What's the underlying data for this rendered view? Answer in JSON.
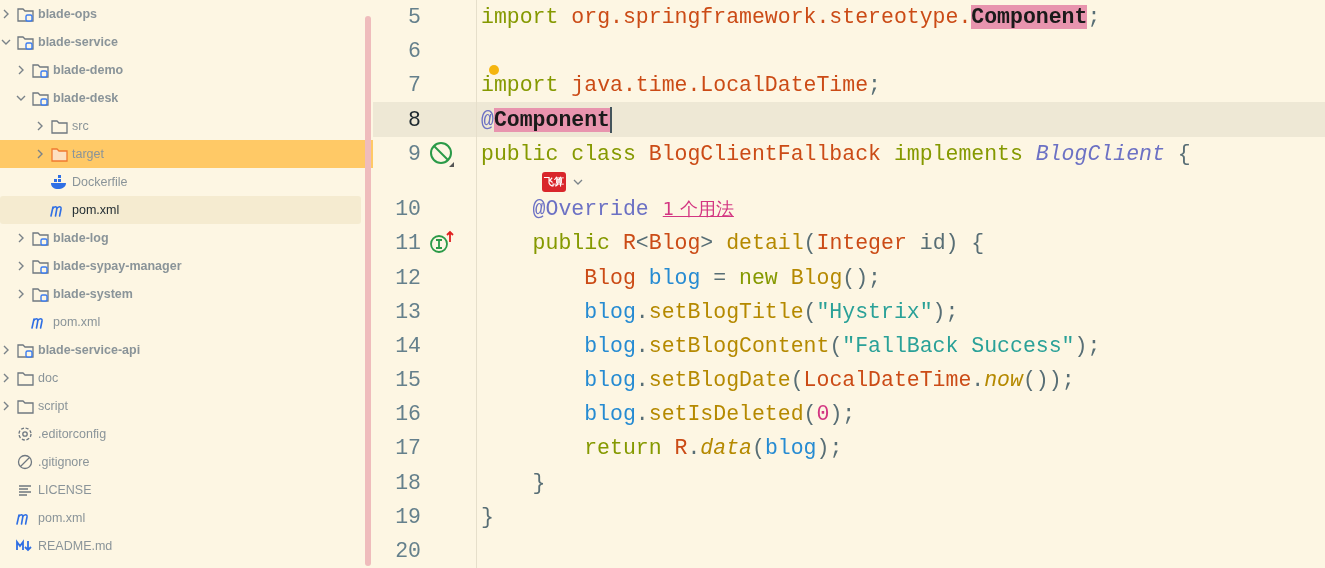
{
  "project_tree": {
    "items": [
      {
        "label": "blade-ops",
        "kind": "module",
        "expanded": false,
        "selected": false
      },
      {
        "label": "blade-service",
        "kind": "module",
        "expanded": true,
        "selected": false,
        "children": [
          {
            "label": "blade-demo",
            "kind": "module",
            "expanded": false,
            "selected": false
          },
          {
            "label": "blade-desk",
            "kind": "module",
            "expanded": true,
            "selected": false,
            "children": [
              {
                "label": "src",
                "kind": "folder",
                "expanded": false,
                "selected": false
              },
              {
                "label": "target",
                "kind": "excluded-folder",
                "expanded": false,
                "selected": false
              },
              {
                "label": "Dockerfile",
                "kind": "docker",
                "selected": false
              },
              {
                "label": "pom.xml",
                "kind": "maven",
                "selected": true
              }
            ]
          },
          {
            "label": "blade-log",
            "kind": "module",
            "expanded": false,
            "selected": false
          },
          {
            "label": "blade-sypay-manager",
            "kind": "module",
            "expanded": false,
            "selected": false
          },
          {
            "label": "blade-system",
            "kind": "module",
            "expanded": false,
            "selected": false
          },
          {
            "label": "pom.xml",
            "kind": "maven",
            "selected": false
          }
        ]
      },
      {
        "label": "blade-service-api",
        "kind": "module",
        "expanded": false,
        "selected": false
      },
      {
        "label": "doc",
        "kind": "folder",
        "expanded": false,
        "selected": false
      },
      {
        "label": "script",
        "kind": "folder",
        "expanded": false,
        "selected": false
      },
      {
        "label": ".editorconfig",
        "kind": "settings",
        "selected": false
      },
      {
        "label": ".gitignore",
        "kind": "ignore",
        "selected": false
      },
      {
        "label": "LICENSE",
        "kind": "text",
        "selected": false
      },
      {
        "label": "pom.xml",
        "kind": "maven",
        "selected": false
      },
      {
        "label": "README.md",
        "kind": "markdown",
        "selected": false
      }
    ]
  },
  "editor": {
    "lines": [
      {
        "number": "5",
        "selected": false,
        "tokens": [
          {
            "text": "import",
            "kind": "keyword"
          },
          {
            "text": " org.springframework.stereotype.",
            "kind": "class"
          },
          {
            "text": "Component",
            "kind": "match"
          },
          {
            "text": ";",
            "kind": "punct"
          }
        ]
      },
      {
        "number": "6",
        "selected": false
      },
      {
        "number": "7",
        "selected": false,
        "intention": {
          "kind": "bulb"
        },
        "tokens": [
          {
            "text": "import",
            "kind": "keyword"
          },
          {
            "text": " java.time.LocalDateTime",
            "kind": "class"
          },
          {
            "text": ";",
            "kind": "punct"
          }
        ]
      },
      {
        "number": "8",
        "selected": true,
        "tokens": [
          {
            "text": "@",
            "kind": "annotation"
          },
          {
            "text": "Component",
            "kind": "match"
          }
        ]
      },
      {
        "number": "9",
        "selected": false,
        "gutter": {
          "kind": "no-entry"
        },
        "tokens": [
          {
            "text": "public class ",
            "kind": "keyword"
          },
          {
            "text": "BlogClientFallback",
            "kind": "class"
          },
          {
            "text": " implements ",
            "kind": "keyword"
          },
          {
            "text": "BlogClient",
            "kind": "interface"
          },
          {
            "text": " {",
            "kind": "punct"
          }
        ],
        "inlay": {
          "logo": "飞算"
        }
      },
      {
        "number": "10",
        "selected": false,
        "tokens": [
          {
            "text": "    @Override",
            "kind": "annotation"
          }
        ],
        "hint": "1 个用法"
      },
      {
        "number": "11",
        "selected": false,
        "gutter": {
          "kind": "implements"
        },
        "tokens": [
          {
            "text": "    public ",
            "kind": "keyword"
          },
          {
            "text": "R",
            "kind": "class"
          },
          {
            "text": "<",
            "kind": "punct"
          },
          {
            "text": "Blog",
            "kind": "class"
          },
          {
            "text": "> ",
            "kind": "punct"
          },
          {
            "text": "detail",
            "kind": "method"
          },
          {
            "text": "(",
            "kind": "punct"
          },
          {
            "text": "Integer",
            "kind": "class"
          },
          {
            "text": " id) {",
            "kind": "punct"
          }
        ]
      },
      {
        "number": "12",
        "selected": false,
        "tokens": [
          {
            "text": "        Blog",
            "kind": "class"
          },
          {
            "text": " blog",
            "kind": "local"
          },
          {
            "text": " = ",
            "kind": "punct"
          },
          {
            "text": "new",
            "kind": "keyword"
          },
          {
            "text": " Blog",
            "kind": "method"
          },
          {
            "text": "();",
            "kind": "punct"
          }
        ]
      },
      {
        "number": "13",
        "selected": false,
        "tokens": [
          {
            "text": "        blog",
            "kind": "local"
          },
          {
            "text": ".",
            "kind": "punct"
          },
          {
            "text": "setBlogTitle",
            "kind": "method"
          },
          {
            "text": "(",
            "kind": "punct"
          },
          {
            "text": "\"Hystrix\"",
            "kind": "string"
          },
          {
            "text": ");",
            "kind": "punct"
          }
        ]
      },
      {
        "number": "14",
        "selected": false,
        "tokens": [
          {
            "text": "        blog",
            "kind": "local"
          },
          {
            "text": ".",
            "kind": "punct"
          },
          {
            "text": "setBlogContent",
            "kind": "method"
          },
          {
            "text": "(",
            "kind": "punct"
          },
          {
            "text": "\"FallBack Success\"",
            "kind": "string"
          },
          {
            "text": ");",
            "kind": "punct"
          }
        ]
      },
      {
        "number": "15",
        "selected": false,
        "tokens": [
          {
            "text": "        blog",
            "kind": "local"
          },
          {
            "text": ".",
            "kind": "punct"
          },
          {
            "text": "setBlogDate",
            "kind": "method"
          },
          {
            "text": "(",
            "kind": "punct"
          },
          {
            "text": "LocalDateTime",
            "kind": "class"
          },
          {
            "text": ".",
            "kind": "punct"
          },
          {
            "text": "now",
            "kind": "static"
          },
          {
            "text": "());",
            "kind": "punct"
          }
        ]
      },
      {
        "number": "16",
        "selected": false,
        "tokens": [
          {
            "text": "        blog",
            "kind": "local"
          },
          {
            "text": ".",
            "kind": "punct"
          },
          {
            "text": "setIsDeleted",
            "kind": "method"
          },
          {
            "text": "(",
            "kind": "punct"
          },
          {
            "text": "0",
            "kind": "number"
          },
          {
            "text": ");",
            "kind": "punct"
          }
        ]
      },
      {
        "number": "17",
        "selected": false,
        "tokens": [
          {
            "text": "        return",
            "kind": "keyword"
          },
          {
            "text": " R",
            "kind": "class"
          },
          {
            "text": ".",
            "kind": "punct"
          },
          {
            "text": "data",
            "kind": "static"
          },
          {
            "text": "(",
            "kind": "punct"
          },
          {
            "text": "blog",
            "kind": "local"
          },
          {
            "text": ");",
            "kind": "punct"
          }
        ]
      },
      {
        "number": "18",
        "selected": false,
        "tokens": [
          {
            "text": "    }",
            "kind": "punct"
          }
        ]
      },
      {
        "number": "19",
        "selected": false,
        "tokens": [
          {
            "text": "}",
            "kind": "punct"
          }
        ]
      },
      {
        "number": "20",
        "selected": false
      }
    ]
  }
}
